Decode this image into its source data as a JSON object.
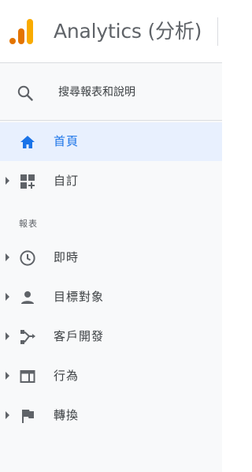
{
  "header": {
    "app_title": "Analytics (分析)",
    "logo_colors": [
      "#f9ab00",
      "#e37400"
    ]
  },
  "search": {
    "icon": "search-icon",
    "label": "搜尋報表和說明"
  },
  "nav": {
    "items": [
      {
        "id": "home",
        "label": "首頁",
        "icon": "home-icon",
        "active": true,
        "expandable": false
      },
      {
        "id": "customization",
        "label": "自訂",
        "icon": "dashboard-add-icon",
        "active": false,
        "expandable": true
      }
    ],
    "section_label": "報表",
    "report_items": [
      {
        "id": "realtime",
        "label": "即時",
        "icon": "clock-icon",
        "expandable": true
      },
      {
        "id": "audience",
        "label": "目標對象",
        "icon": "person-icon",
        "expandable": true
      },
      {
        "id": "acquisition",
        "label": "客戶開發",
        "icon": "acquisition-icon",
        "expandable": true
      },
      {
        "id": "behavior",
        "label": "行為",
        "icon": "behavior-window-icon",
        "expandable": true
      },
      {
        "id": "conversions",
        "label": "轉換",
        "icon": "flag-icon",
        "expandable": true
      }
    ]
  },
  "colors": {
    "accent": "#1a73e8",
    "active_bg": "#e8f0fe",
    "icon": "#5f6368",
    "sidebar_bg": "#f8f9fa"
  }
}
